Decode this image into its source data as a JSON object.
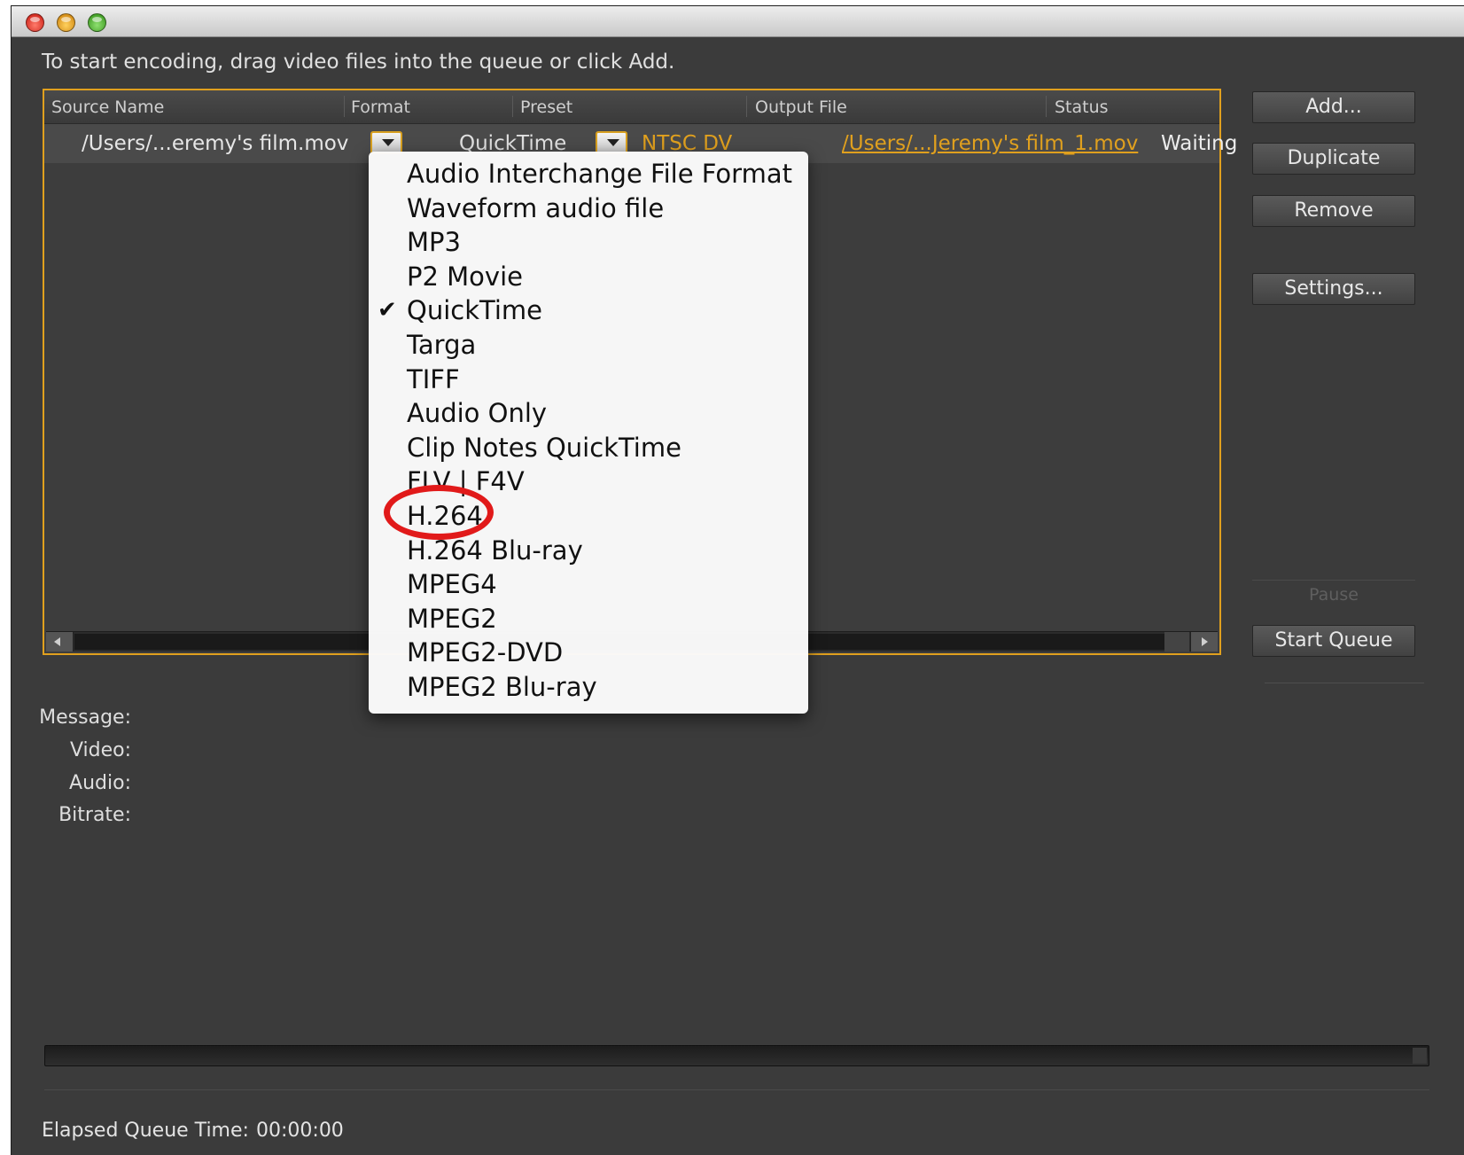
{
  "window": {
    "instruction": "To start encoding, drag video files into the queue or click Add."
  },
  "queue": {
    "columns": [
      "Source Name",
      "Format",
      "Preset",
      "Output File",
      "Status"
    ],
    "row": {
      "source": "/Users/...eremy's film.mov",
      "format": "QuickTime",
      "preset": "NTSC DV",
      "output": "/Users/...Jeremy's film_1.mov",
      "status": "Waiting"
    }
  },
  "buttons": {
    "add": "Add...",
    "duplicate": "Duplicate",
    "remove": "Remove",
    "settings": "Settings...",
    "pause": "Pause",
    "start_queue": "Start Queue"
  },
  "format_menu": {
    "selected": "QuickTime",
    "highlighted": "H.264",
    "items": [
      "Audio Interchange File Format",
      "Waveform audio file",
      "MP3",
      "P2 Movie",
      "QuickTime",
      "Targa",
      "TIFF",
      "Audio Only",
      "Clip Notes QuickTime",
      "FLV | F4V",
      "H.264",
      "H.264 Blu-ray",
      "MPEG4",
      "MPEG2",
      "MPEG2-DVD",
      "MPEG2 Blu-ray"
    ],
    "highlight_color": "#e11a1a"
  },
  "info": {
    "message_label": "Message:",
    "video_label": "Video:",
    "audio_label": "Audio:",
    "bitrate_label": "Bitrate:"
  },
  "footer": {
    "elapsed_label": "Elapsed Queue Time:",
    "elapsed_value": "00:00:00"
  },
  "colors": {
    "accent": "#e0a01e",
    "background": "#3b3b3b"
  }
}
